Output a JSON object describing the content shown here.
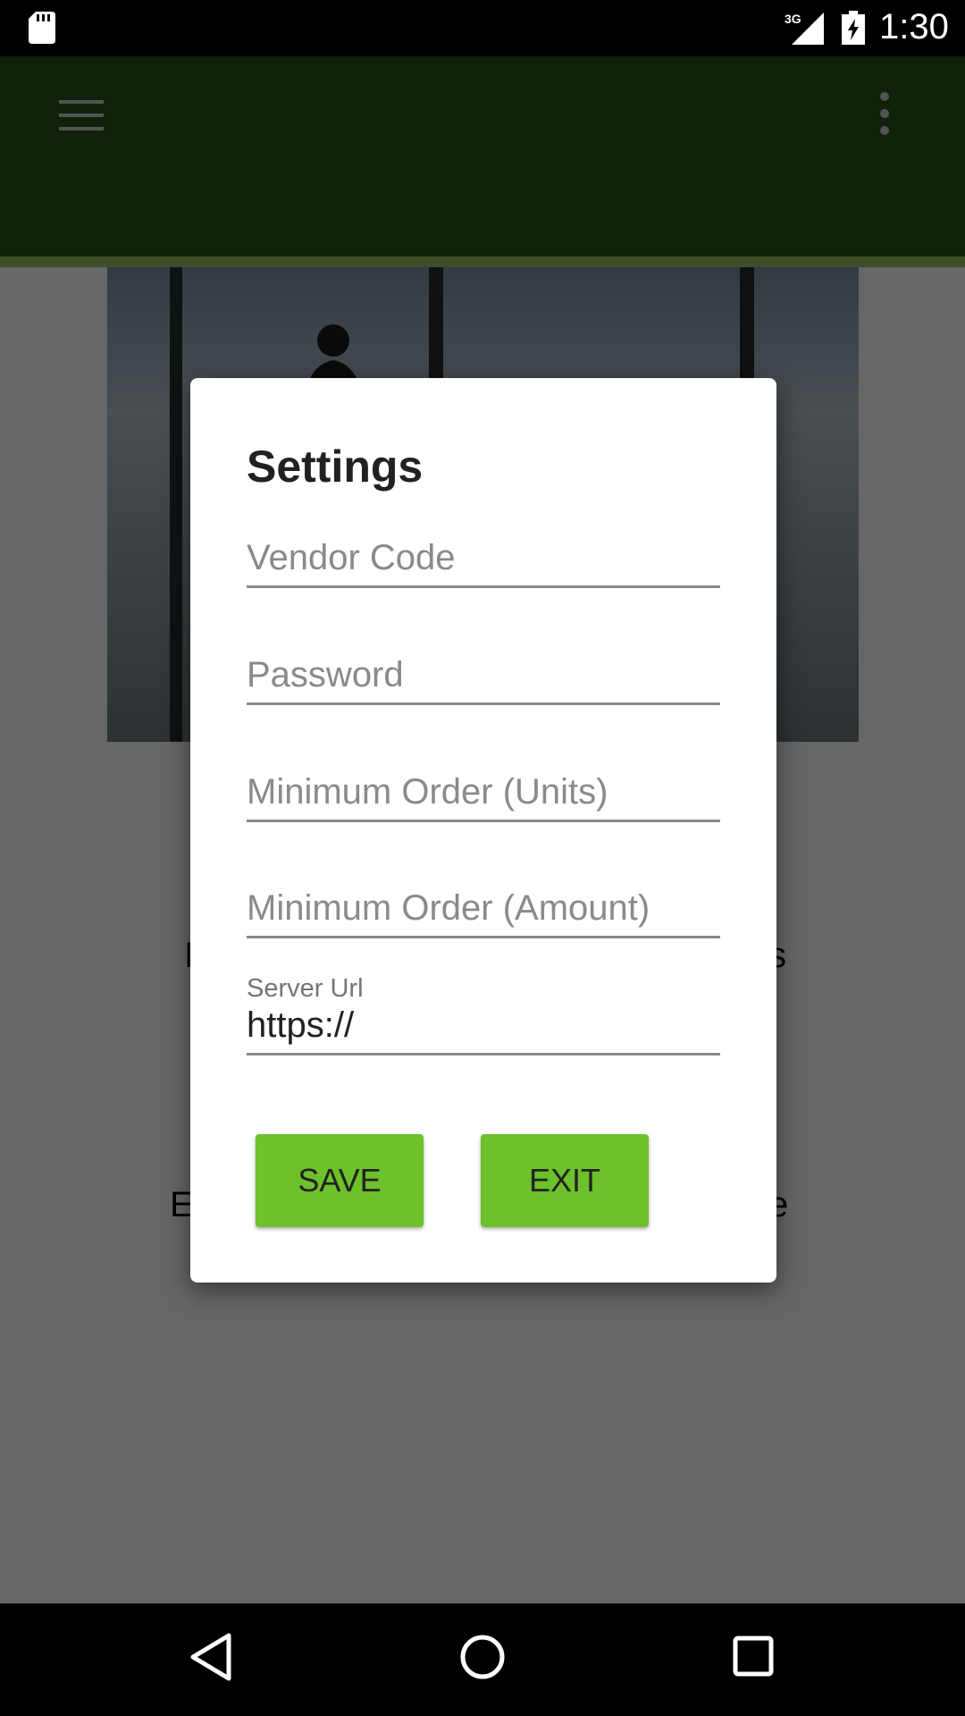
{
  "status_bar": {
    "time": "1:30",
    "network": "3G",
    "icons": [
      "sd-card-icon",
      "signal-icon",
      "battery-charging-icon"
    ]
  },
  "app_bar": {
    "menu_icon": "hamburger-menu-icon",
    "overflow_icon": "more-vert-icon",
    "color": "#2a5419",
    "stripe_color": "#9bc26a"
  },
  "background": {
    "text_line_1_left": "I",
    "text_line_1_right": "s",
    "text_line_2_left": "E",
    "text_line_2_right": "e"
  },
  "dialog": {
    "title": "Settings",
    "fields": {
      "vendor_code": {
        "placeholder": "Vendor Code",
        "value": ""
      },
      "password": {
        "placeholder": "Password",
        "value": ""
      },
      "min_order_units": {
        "placeholder": "Minimum Order (Units)",
        "value": ""
      },
      "min_order_amount": {
        "placeholder": "Minimum Order (Amount)",
        "value": ""
      },
      "server_url": {
        "label": "Server Url",
        "value": "https://"
      }
    },
    "buttons": {
      "save": "SAVE",
      "exit": "EXIT"
    },
    "button_color": "#6dc12a"
  },
  "nav_bar": {
    "icons": [
      "back-icon",
      "home-icon",
      "recent-apps-icon"
    ]
  }
}
